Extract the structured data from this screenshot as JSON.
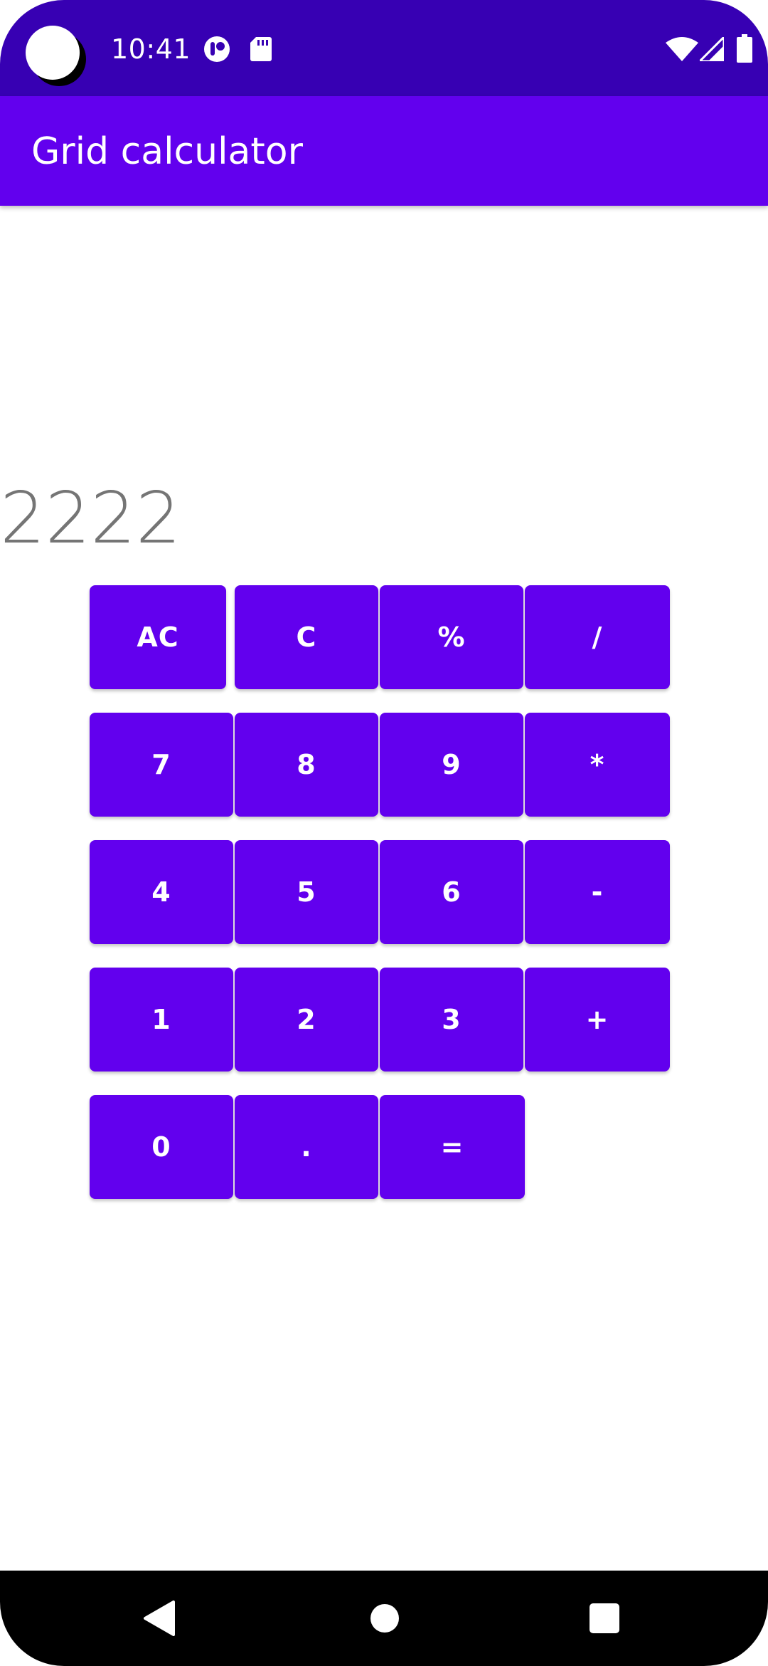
{
  "status_bar": {
    "time": "10:41",
    "icons": [
      "notification-app-icon",
      "sd-card-icon",
      "wifi-icon",
      "signal-icon",
      "battery-icon"
    ]
  },
  "app_bar": {
    "title": "Grid calculator"
  },
  "display": {
    "value": "2222"
  },
  "keypad": {
    "ac": "AC",
    "c": "C",
    "percent": "%",
    "divide": "/",
    "seven": "7",
    "eight": "8",
    "nine": "9",
    "multiply": "*",
    "four": "4",
    "five": "5",
    "six": "6",
    "minus": "-",
    "one": "1",
    "two": "2",
    "three": "3",
    "plus": "+",
    "zero": "0",
    "dot": ".",
    "equals": "="
  },
  "nav_bar": {
    "icons": [
      "back-icon",
      "home-icon",
      "recents-icon"
    ]
  },
  "colors": {
    "status_bar": "#3700b3",
    "primary": "#6200ee",
    "display_text": "#757575"
  }
}
